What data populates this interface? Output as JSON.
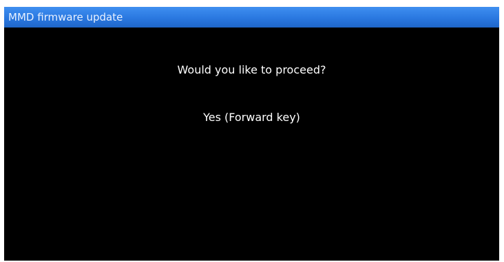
{
  "window": {
    "title": "MMD firmware update"
  },
  "dialog": {
    "prompt": "Would you like to proceed?",
    "option_yes": "Yes (Forward key)"
  },
  "colors": {
    "title_bar": "#2a78e0",
    "background": "#000000",
    "text": "#ffffff"
  }
}
